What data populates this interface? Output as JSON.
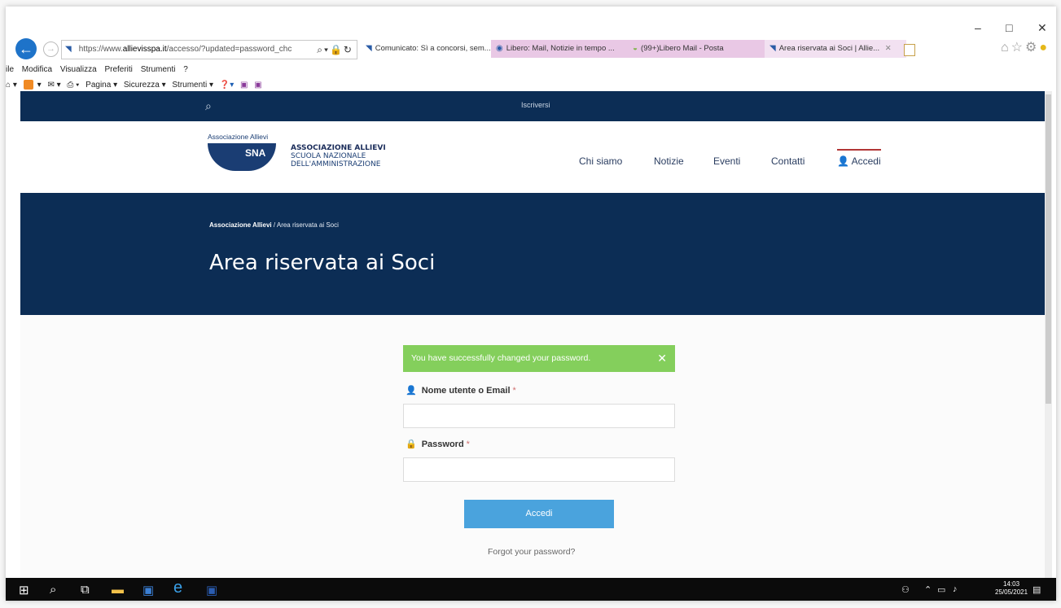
{
  "browser": {
    "url_prefix": "https://www.",
    "url_host": "allievisspa.it",
    "url_path": "/accesso/?updated=password_chc",
    "tabs": [
      {
        "label": "Comunicato: Sì a concorsi, sem..."
      },
      {
        "label": "Libero: Mail, Notizie in tempo ..."
      },
      {
        "label": "(99+)Libero Mail - Posta"
      },
      {
        "label": "Area riservata ai Soci | Allie..."
      }
    ],
    "menu": [
      "ile",
      "Modifica",
      "Visualizza",
      "Preferiti",
      "Strumenti",
      "?"
    ],
    "commands": [
      "Pagina ▾",
      "Sicurezza ▾",
      "Strumenti ▾"
    ]
  },
  "site": {
    "topbar_link": "Iscriversi",
    "logo_top": "Associazione Allievi",
    "logo_mark": "SNA",
    "org_line1": "ASSOCIAZIONE ALLIEVI",
    "org_line2": "SCUOLA NAZIONALE",
    "org_line3": "DELL'AMMINISTRAZIONE",
    "nav": [
      {
        "label": "Chi siamo"
      },
      {
        "label": "Notizie"
      },
      {
        "label": "Eventi"
      },
      {
        "label": "Contatti"
      },
      {
        "label": "Accedi"
      }
    ],
    "breadcrumb_root": "Associazione Allievi",
    "breadcrumb_sep": " / ",
    "breadcrumb_current": "Area riservata ai Soci",
    "page_title": "Area riservata ai Soci"
  },
  "form": {
    "alert": "You have successfully changed your password.",
    "alert_close": "✕",
    "username_label": "Nome utente o Email",
    "username_value": "",
    "password_label": "Password",
    "password_value": "",
    "required_mark": "*",
    "submit_label": "Accedi",
    "forgot_label": "Forgot your password?"
  },
  "taskbar": {
    "time": "14:03",
    "date": "25/05/2021"
  },
  "colors": {
    "navy": "#0c2d55",
    "success": "#84cf5c",
    "button": "#4aa3dd",
    "active_nav": "#b23636"
  }
}
